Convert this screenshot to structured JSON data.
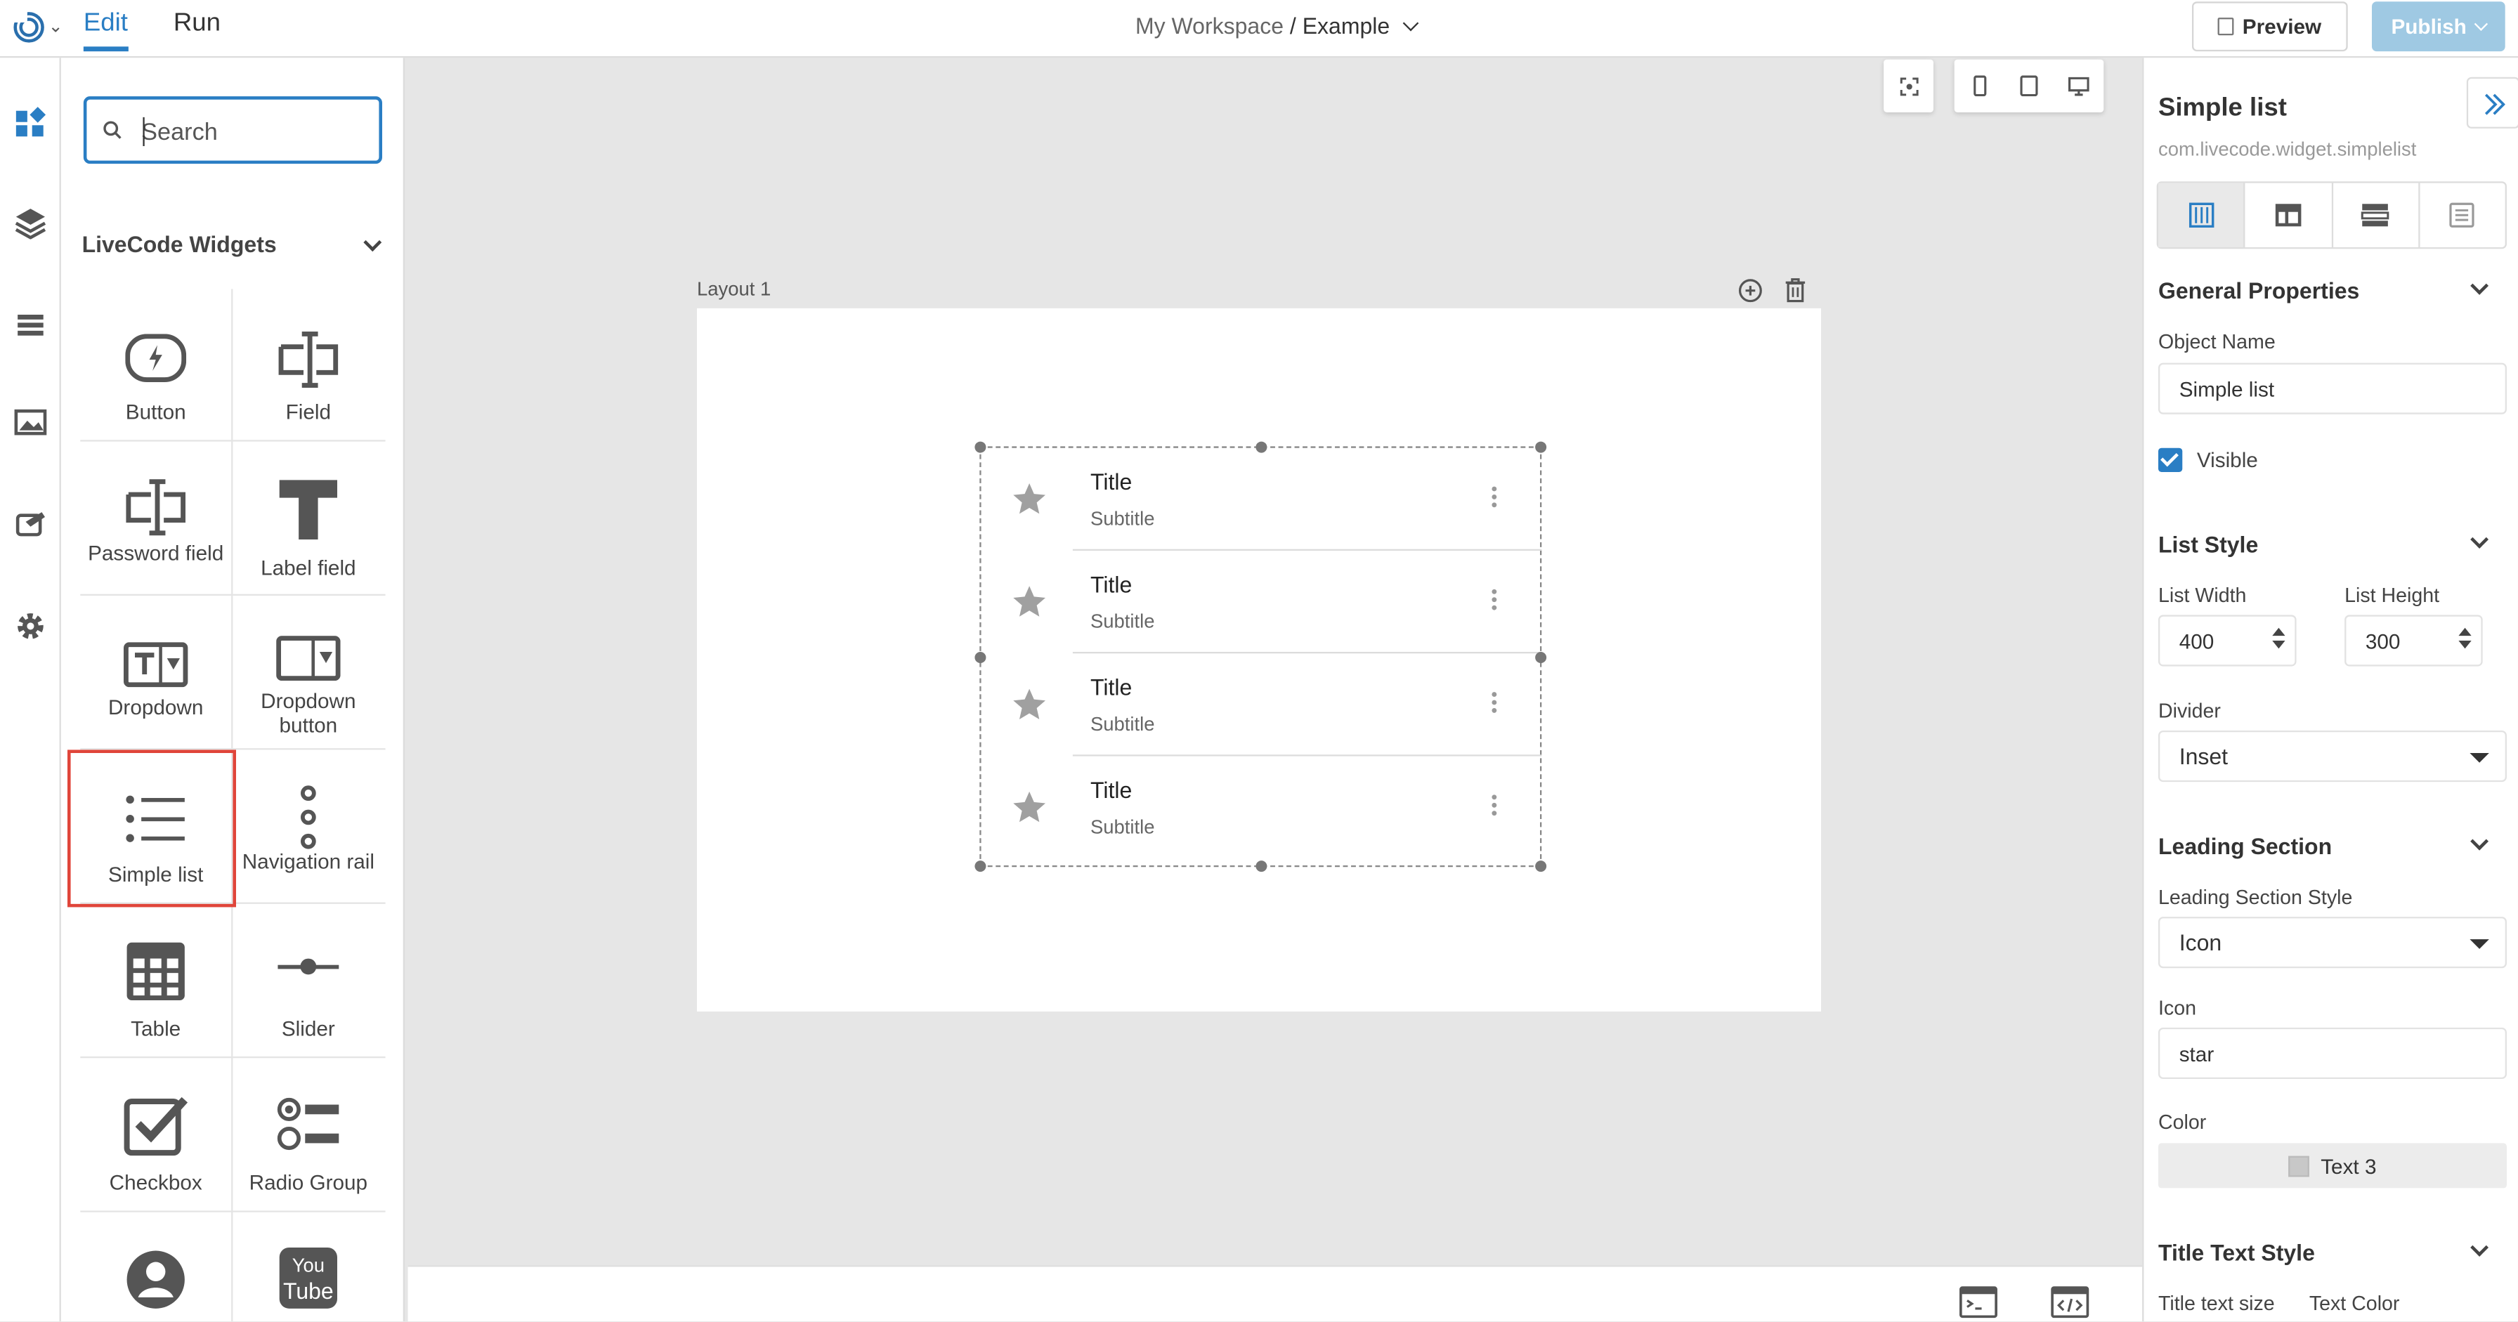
{
  "topbar": {
    "tab_edit": "Edit",
    "tab_run": "Run",
    "workspace": "My Workspace",
    "project": "/ Example",
    "preview_label": "Preview",
    "publish_label": "Publish"
  },
  "colors": {
    "accent": "#2a7ec4",
    "publish_bg": "#9fc9e3",
    "selection": "#e0453a"
  },
  "rail": {
    "icons": [
      "widgets-icon",
      "layers-icon",
      "list-icon",
      "image-icon",
      "palette-icon",
      "gear-icon"
    ]
  },
  "widgets_panel": {
    "search_placeholder": "Search",
    "group_title": "LiveCode Widgets",
    "items": [
      {
        "label": "Button",
        "icon": "button-icon"
      },
      {
        "label": "Field",
        "icon": "field-icon"
      },
      {
        "label": "Password field",
        "icon": "password-field-icon"
      },
      {
        "label": "Label field",
        "icon": "label-field-icon"
      },
      {
        "label": "Dropdown",
        "icon": "dropdown-icon"
      },
      {
        "label": "Dropdown button",
        "icon": "dropdown-button-icon"
      },
      {
        "label": "Simple list",
        "icon": "simple-list-icon"
      },
      {
        "label": "Navigation rail",
        "icon": "navigation-rail-icon"
      },
      {
        "label": "Table",
        "icon": "table-icon"
      },
      {
        "label": "Slider",
        "icon": "slider-icon"
      },
      {
        "label": "Checkbox",
        "icon": "checkbox-icon"
      },
      {
        "label": "Radio Group",
        "icon": "radio-group-icon"
      },
      {
        "label": "",
        "icon": "avatar-icon"
      },
      {
        "label": "",
        "icon": "youtube-icon"
      }
    ],
    "selected": "Simple list"
  },
  "canvas": {
    "layout_label": "Layout 1",
    "list_items": [
      {
        "title": "Title",
        "subtitle": "Subtitle"
      },
      {
        "title": "Title",
        "subtitle": "Subtitle"
      },
      {
        "title": "Title",
        "subtitle": "Subtitle"
      },
      {
        "title": "Title",
        "subtitle": "Subtitle"
      }
    ]
  },
  "properties": {
    "title": "Simple list",
    "widget_id": "com.livecode.widget.simplelist",
    "general_heading": "General Properties",
    "object_name_label": "Object Name",
    "object_name_value": "Simple list",
    "visible_label": "Visible",
    "visible_checked": true,
    "list_style_heading": "List Style",
    "list_width_label": "List Width",
    "list_width_value": "400",
    "list_height_label": "List Height",
    "list_height_value": "300",
    "divider_label": "Divider",
    "divider_value": "Inset",
    "leading_heading": "Leading Section",
    "leading_style_label": "Leading Section Style",
    "leading_style_value": "Icon",
    "icon_label": "Icon",
    "icon_value": "star",
    "color_label": "Color",
    "color_value": "Text 3",
    "title_text_heading": "Title Text Style",
    "title_text_size_label": "Title text size",
    "text_color_label": "Text Color"
  }
}
